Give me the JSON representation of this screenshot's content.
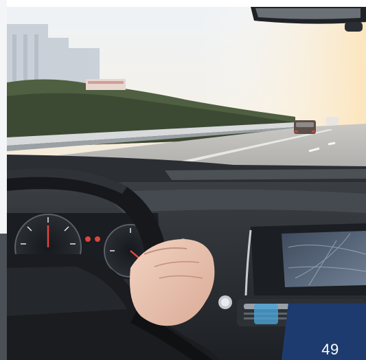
{
  "page": {
    "number": "49"
  },
  "photo": {
    "subject": "driver-hand-on-steering-wheel-highway-view"
  },
  "colors": {
    "badge": "#1d3b6e",
    "badge_text": "#ffffff",
    "left_strip_light": "#f4f5f7",
    "left_strip_dark": "#4b4f56"
  }
}
